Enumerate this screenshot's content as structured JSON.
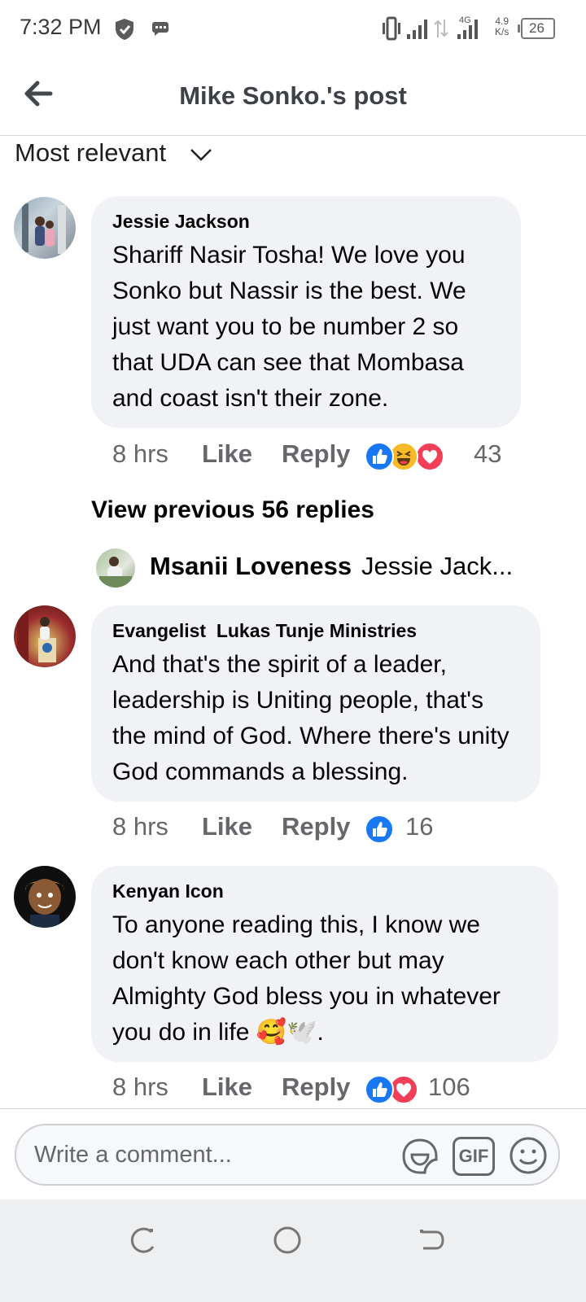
{
  "status_bar": {
    "time": "7:32 PM",
    "net_speed_value": "4.9",
    "net_speed_unit": "K/s",
    "network_type": "4G",
    "battery": "26"
  },
  "header": {
    "title": "Mike Sonko.'s post",
    "back_icon": "arrow-left-icon"
  },
  "sort": {
    "label": "Most relevant"
  },
  "comments": [
    {
      "author": "Jessie Jackson",
      "text": "Shariff Nasir Tosha! We love you Sonko but Nassir is the best. We just want you to be number 2 so that UDA can see that Mombasa and coast isn't their zone.",
      "time": "8 hrs",
      "like": "Like",
      "reply": "Reply",
      "reactions": [
        "like",
        "haha",
        "love"
      ],
      "reaction_count": "43"
    },
    {
      "author": "Evangelist  Lukas Tunje Ministries",
      "text": "And that's the spirit of a leader, leadership is Uniting people, that's the mind of God. Where there's unity God commands a blessing.",
      "time": "8 hrs",
      "like": "Like",
      "reply": "Reply",
      "reactions": [
        "like"
      ],
      "reaction_count": "16"
    },
    {
      "author": "Kenyan Icon",
      "text": "To anyone reading this, I know we don't know each other but may Almighty God bless you in whatever you do in life 🥰🕊️.",
      "time": "8 hrs",
      "like": "Like",
      "reply": "Reply",
      "reactions": [
        "like",
        "love"
      ],
      "reaction_count": "106"
    }
  ],
  "replies_section": {
    "view_previous": "View previous 56 replies",
    "preview_author": "Msanii Loveness",
    "preview_text": "Jessie Jack..."
  },
  "composer": {
    "placeholder": "Write a comment...",
    "gif_label": "GIF"
  },
  "colors": {
    "bubble": "#f0f2f5",
    "secondary_text": "#65676b",
    "like_blue": "#1877f2",
    "love_red": "#f33e58",
    "haha_yellow": "#f7b928"
  }
}
